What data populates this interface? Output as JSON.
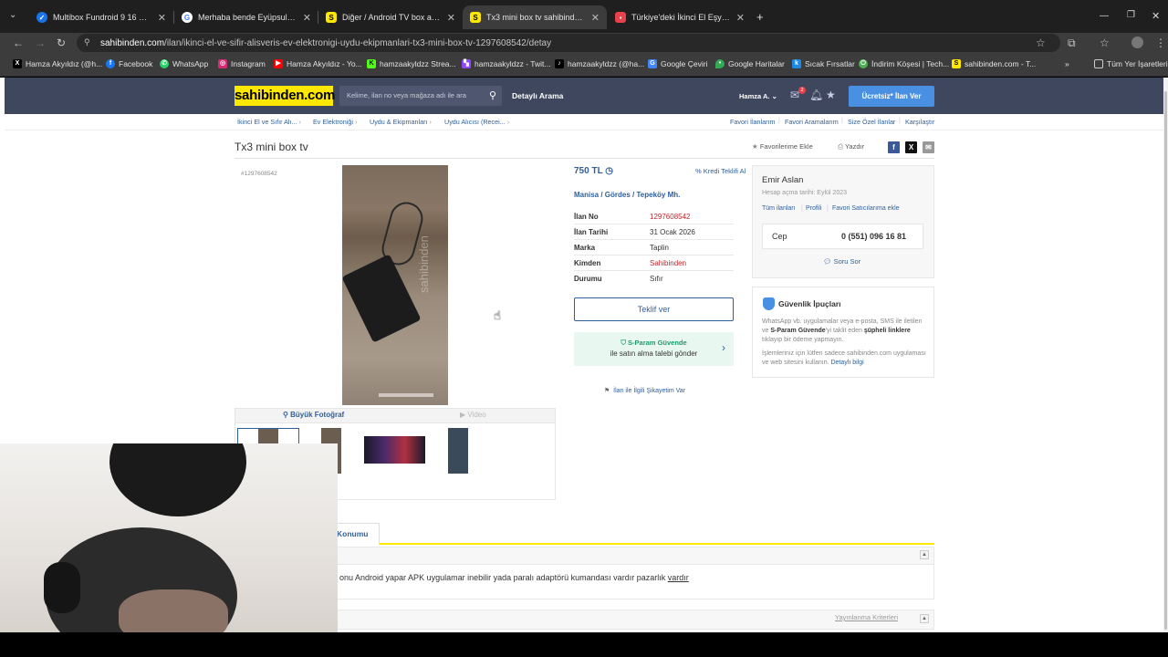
{
  "browser": {
    "tabs": [
      {
        "title": "Multibox Fundroid 9 16 GB 4K A",
        "favicon": "check-favicon",
        "fav_color": "#1a73e8"
      },
      {
        "title": "Merhaba bende Eyüpsultan'da",
        "favicon": "google-favicon",
        "fav_color": "#ffffff"
      },
      {
        "title": "Diğer / Android TV box akıllı ku",
        "favicon": "S",
        "fav_color": "#ffe800"
      },
      {
        "title": "Tx3 mini box tv sahibinden.com",
        "favicon": "S",
        "fav_color": "#ffe800"
      },
      {
        "title": "Türkiye'deki İkinci El Eşyalar Al",
        "favicon": "red-favicon",
        "fav_color": "#e8414b"
      }
    ],
    "new_tab": "+",
    "url_domain": "sahibinden.com",
    "url_path": "/ilan/ikinci-el-ve-sifir-alisveris-ev-elektronigi-uydu-ekipmanlari-tx3-mini-box-tv-1297608542/detay",
    "bookmarks": [
      {
        "label": "Hamza Akyıldız (@h...",
        "icon": "x-icon",
        "color": "#000000"
      },
      {
        "label": "Facebook",
        "icon": "facebook-icon",
        "color": "#1877f2"
      },
      {
        "label": "WhatsApp",
        "icon": "whatsapp-icon",
        "color": "#25d366"
      },
      {
        "label": "Instagram",
        "icon": "instagram-icon",
        "color": "#d62976"
      },
      {
        "label": "Hamza Akyıldız - Yo...",
        "icon": "youtube-icon",
        "color": "#ff0000"
      },
      {
        "label": "hamzaakyldzz Strea...",
        "icon": "kick-icon",
        "color": "#53fc18"
      },
      {
        "label": "hamzaakyldzz - Twit...",
        "icon": "twitch-icon",
        "color": "#9146ff"
      },
      {
        "label": "hamzaakyldzz (@ha...",
        "icon": "tiktok-icon",
        "color": "#000000"
      },
      {
        "label": "Google Çeviri",
        "icon": "translate-icon",
        "color": "#4285f4"
      },
      {
        "label": "Google Haritalar",
        "icon": "maps-icon",
        "color": "#34a853"
      },
      {
        "label": "Sıcak Fırsatlar",
        "icon": "deals-icon",
        "color": "#1e88e5"
      },
      {
        "label": "İndirim Köşesi | Tech...",
        "icon": "power-icon",
        "color": "#4caf50"
      },
      {
        "label": "sahibinden.com - T...",
        "icon": "S",
        "color": "#ffe800"
      }
    ],
    "all_bookmarks": "Tüm Yer İşaretleri"
  },
  "site": {
    "logo": "sahibinden.com",
    "search_placeholder": "Kelime, ilan no veya mağaza adı ile ara",
    "detailed_search": "Detaylı Arama",
    "user": "Hamza A.",
    "msg_count": "2",
    "post_ad": "Ücretsiz* İlan Ver"
  },
  "breadcrumbs": [
    "İkinci El ve Sıfır Alı...",
    "Ev Elektroniği",
    "Uydu & Ekipmanları",
    "Uydu Alıcısı (Recei..."
  ],
  "right_links": [
    "Favori İlanlarım",
    "Favori Aramalarım",
    "Size Özel İlanlar",
    "Karşılaştır"
  ],
  "listing": {
    "title": "Tx3 mini box tv",
    "add_fav": "Favorilerime Ekle",
    "print": "Yazdır",
    "ad_id_small": "#1297608542",
    "photo_watermark": "sahibinden",
    "big_photo": "Büyük Fotoğraf",
    "video": "Video",
    "price": "750 TL",
    "credit": "Kredi Teklifi Al",
    "location": [
      "Manisa",
      "Gördes",
      "Tepeköy Mh."
    ],
    "details": [
      {
        "key": "İlan No",
        "value": "1297608542",
        "red": true
      },
      {
        "key": "İlan Tarihi",
        "value": "31 Ocak 2026",
        "red": false
      },
      {
        "key": "Marka",
        "value": "Taplin",
        "red": false
      },
      {
        "key": "Kimden",
        "value": "Sahibinden",
        "red": true
      },
      {
        "key": "Durumu",
        "value": "Sıfır",
        "red": false
      }
    ],
    "offer_btn": "Teklif ver",
    "sparam_title": "S-Param Güvende",
    "sparam_sub": "ile satın alma talebi gönder",
    "complaint": "İlan ile İlgili Şikayetim Var"
  },
  "seller": {
    "name": "Emir Aslan",
    "since": "Hesap açma tarihi: Eylül 2023",
    "links": [
      "Tüm ilanları",
      "Profili",
      "Favori Satıcılarıma ekle"
    ],
    "phone_label": "Cep",
    "phone": "0 (551) 096 16 81",
    "ask": "Soru Sor"
  },
  "security": {
    "title": "Güvenlik İpuçları",
    "text1_a": "WhatsApp vb. uygulamalar veya e-posta, SMS ile iletilen ve ",
    "text1_b": "S-Param Güvende",
    "text1_c": "'yi taklit eden ",
    "text1_d": "şüpheli linklere",
    "text1_e": " tıklayıp bir ödeme yapmayın.",
    "text2": "İşlemleriniz için lütfen sadece sahibinden.com uygulaması ve web sitesini kullanın. ",
    "text2_link": "Detaylı bilgi"
  },
  "tabs": {
    "konum": "Konumu"
  },
  "description": {
    "text": "onu Android yapar APK uygulamar inebilir yada paralı adaptörü kumandası vardır pazarlık ",
    "underlined": "vardır",
    "criteria": "Yayınlanma Kriterleri"
  }
}
